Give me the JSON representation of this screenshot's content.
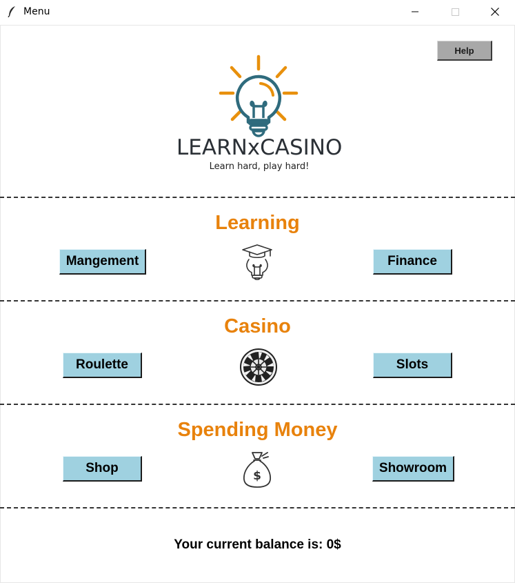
{
  "window": {
    "title": "Menu",
    "icon": "feather-icon",
    "controls": [
      "minimize-icon",
      "maximize-icon",
      "close-icon"
    ]
  },
  "header": {
    "help_label": "Help",
    "logo_name": "LEARNxCASINO",
    "tagline": "Learn hard, play hard!",
    "logo_icon": "lightbulb-icon"
  },
  "sections": [
    {
      "title": "Learning",
      "left_button": "Mangement",
      "right_button": "Finance",
      "icon": "graduation-lightbulb-icon"
    },
    {
      "title": "Casino",
      "left_button": "Roulette",
      "right_button": "Slots",
      "icon": "roulette-wheel-icon"
    },
    {
      "title": "Spending Money",
      "left_button": "Shop",
      "right_button": "Showroom",
      "icon": "money-bag-icon"
    }
  ],
  "footer": {
    "balance_text": "Your current balance is: 0$"
  },
  "colors": {
    "accent": "#e8820c",
    "button": "#9fd1e0",
    "help_button": "#a8a8a8",
    "logo_teal": "#2f6b7d",
    "logo_orange": "#e8900c"
  }
}
